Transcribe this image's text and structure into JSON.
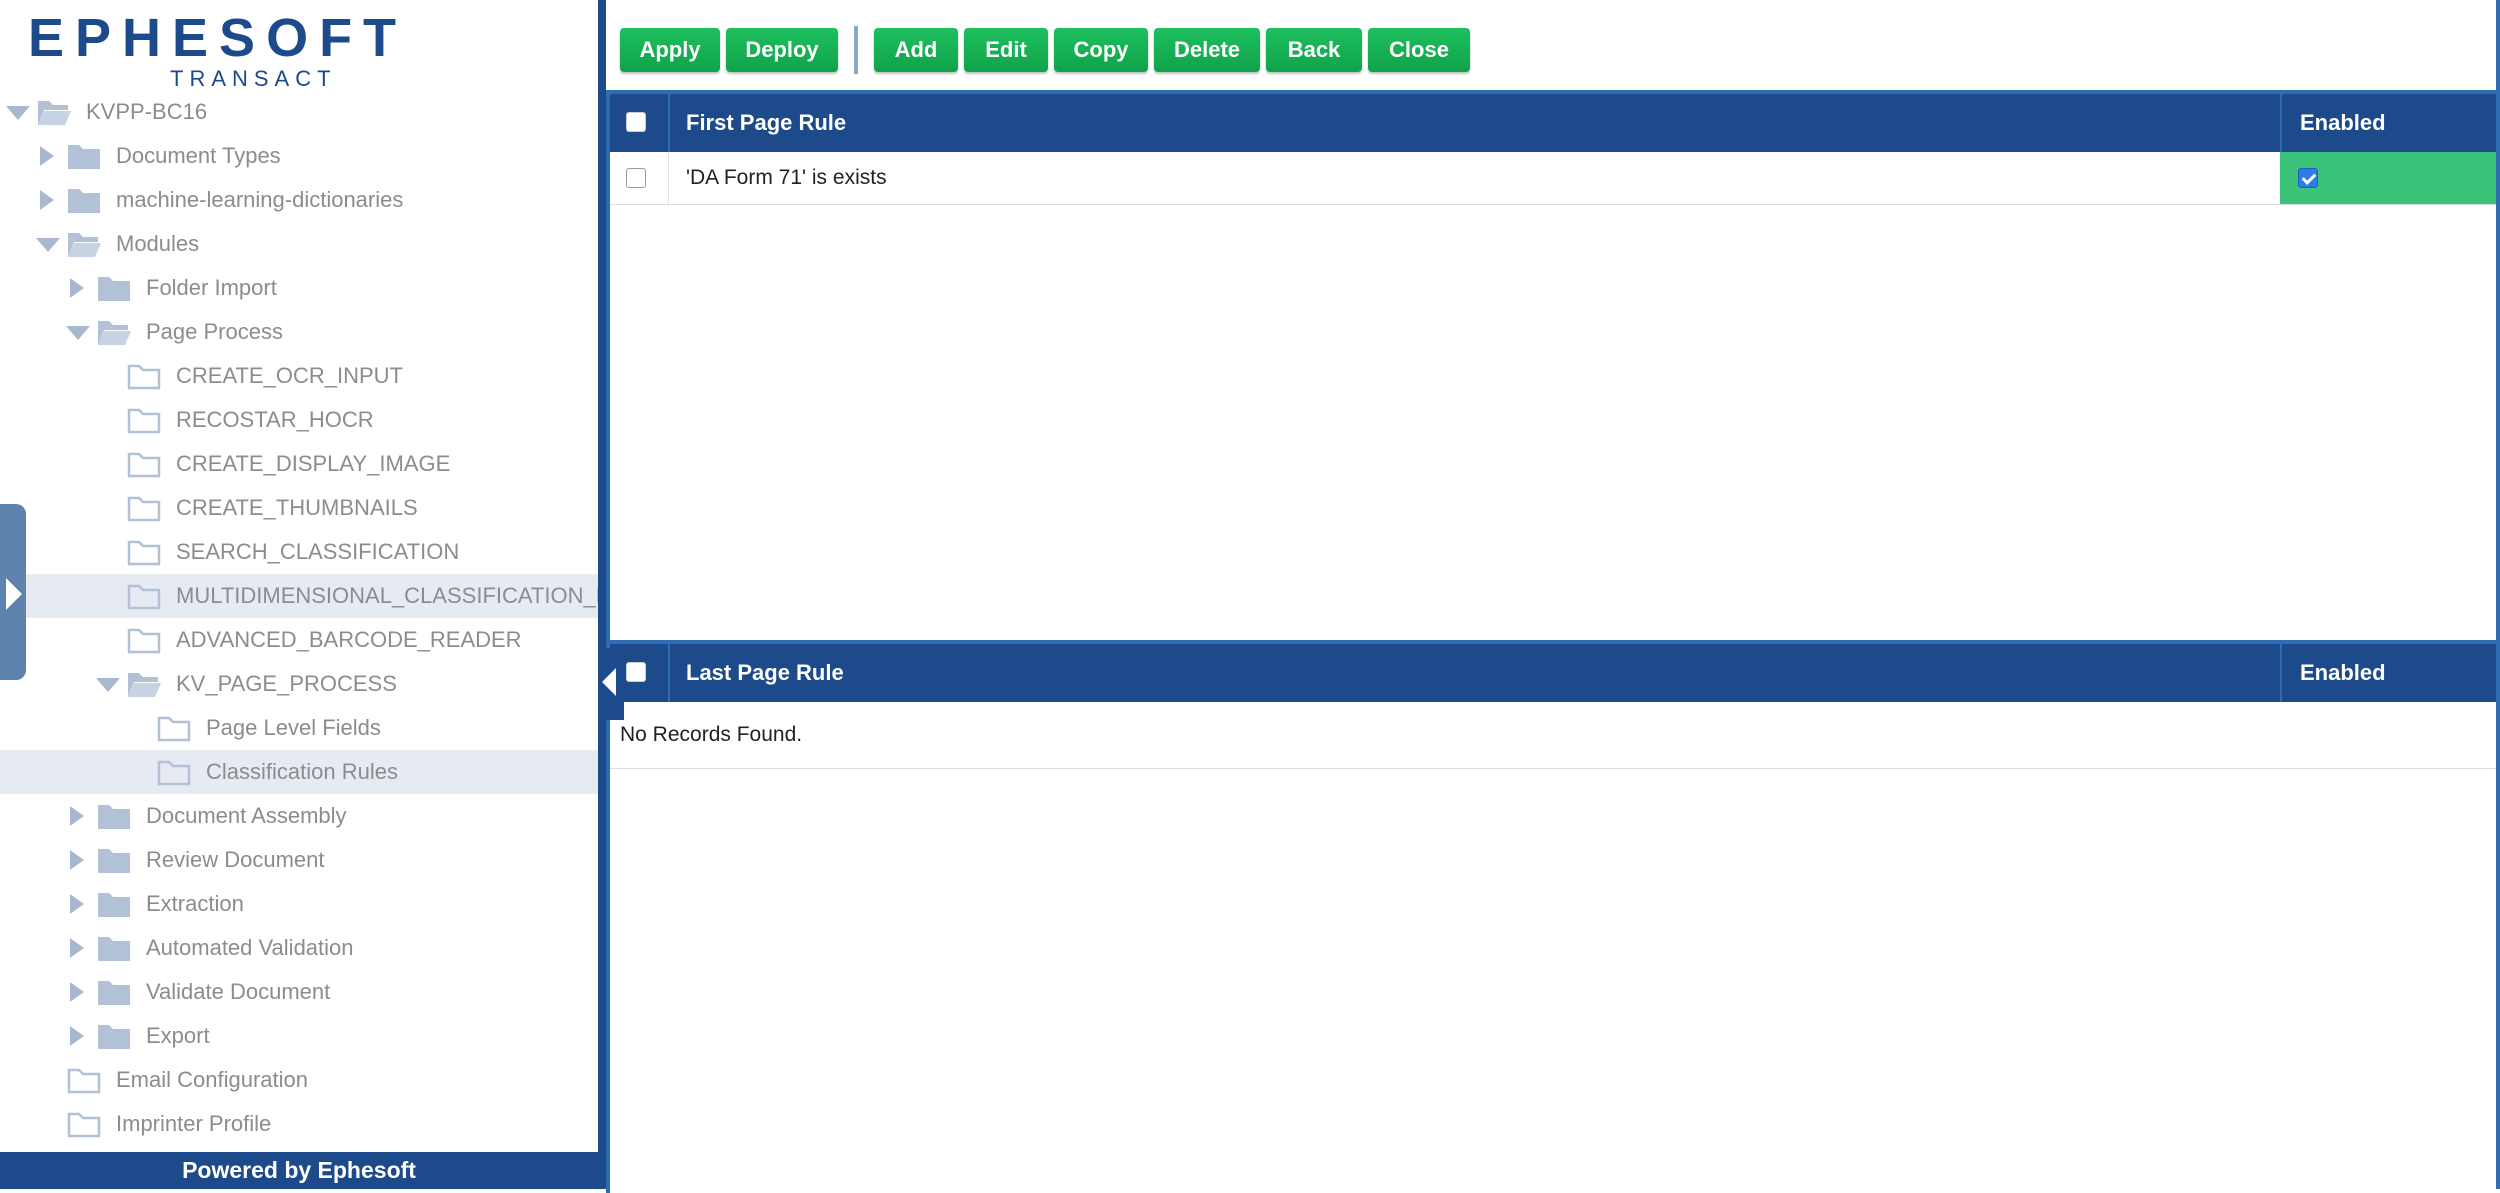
{
  "brand": {
    "logo_word": "EPHESOFT",
    "logo_sub": "TRANSACT",
    "footer": "Powered by Ephesoft"
  },
  "colors": {
    "accent": "#1c4a8a",
    "button": "#12ad50",
    "enabled_cell": "#3cc37a",
    "tree_text": "#8c8c8c"
  },
  "tree": [
    {
      "label": "KVPP-BC16",
      "level": 0,
      "toggle": "expanded",
      "folder": "open-filled"
    },
    {
      "label": "Document Types",
      "level": 1,
      "toggle": "collapsed",
      "folder": "filled"
    },
    {
      "label": "machine-learning-dictionaries",
      "level": 1,
      "toggle": "collapsed",
      "folder": "filled"
    },
    {
      "label": "Modules",
      "level": 1,
      "toggle": "expanded",
      "folder": "open-filled"
    },
    {
      "label": "Folder Import",
      "level": 2,
      "toggle": "collapsed",
      "folder": "filled"
    },
    {
      "label": "Page Process",
      "level": 2,
      "toggle": "expanded",
      "folder": "open-filled"
    },
    {
      "label": "CREATE_OCR_INPUT",
      "level": 3,
      "toggle": "none",
      "folder": "outline"
    },
    {
      "label": "RECOSTAR_HOCR",
      "level": 3,
      "toggle": "none",
      "folder": "outline"
    },
    {
      "label": "CREATE_DISPLAY_IMAGE",
      "level": 3,
      "toggle": "none",
      "folder": "outline"
    },
    {
      "label": "CREATE_THUMBNAILS",
      "level": 3,
      "toggle": "none",
      "folder": "outline"
    },
    {
      "label": "SEARCH_CLASSIFICATION",
      "level": 3,
      "toggle": "none",
      "folder": "outline"
    },
    {
      "label": "MULTIDIMENSIONAL_CLASSIFICATION_PLUGIN",
      "level": 3,
      "toggle": "none",
      "folder": "outline",
      "highlight": true
    },
    {
      "label": "ADVANCED_BARCODE_READER",
      "level": 3,
      "toggle": "none",
      "folder": "outline"
    },
    {
      "label": "KV_PAGE_PROCESS",
      "level": 3,
      "toggle": "expanded",
      "folder": "open-filled"
    },
    {
      "label": "Page Level Fields",
      "level": 4,
      "toggle": "none",
      "folder": "outline"
    },
    {
      "label": "Classification Rules",
      "level": 4,
      "toggle": "none",
      "folder": "outline",
      "highlight": true
    },
    {
      "label": "Document Assembly",
      "level": 2,
      "toggle": "collapsed",
      "folder": "filled"
    },
    {
      "label": "Review Document",
      "level": 2,
      "toggle": "collapsed",
      "folder": "filled"
    },
    {
      "label": "Extraction",
      "level": 2,
      "toggle": "collapsed",
      "folder": "filled"
    },
    {
      "label": "Automated Validation",
      "level": 2,
      "toggle": "collapsed",
      "folder": "filled"
    },
    {
      "label": "Validate Document",
      "level": 2,
      "toggle": "collapsed",
      "folder": "filled"
    },
    {
      "label": "Export",
      "level": 2,
      "toggle": "collapsed",
      "folder": "filled"
    },
    {
      "label": "Email Configuration",
      "level": 1,
      "toggle": "none",
      "folder": "outline"
    },
    {
      "label": "Imprinter Profile",
      "level": 1,
      "toggle": "none",
      "folder": "outline"
    }
  ],
  "toolbar": {
    "apply": "Apply",
    "deploy": "Deploy",
    "add": "Add",
    "edit": "Edit",
    "copy": "Copy",
    "delete": "Delete",
    "back": "Back",
    "close": "Close"
  },
  "first_page_grid": {
    "title": "First Page Rule",
    "enabled_header": "Enabled",
    "rows": [
      {
        "rule": "'DA Form 71' is exists",
        "enabled": true
      }
    ]
  },
  "last_page_grid": {
    "title": "Last Page Rule",
    "enabled_header": "Enabled",
    "empty_text": "No Records Found."
  }
}
